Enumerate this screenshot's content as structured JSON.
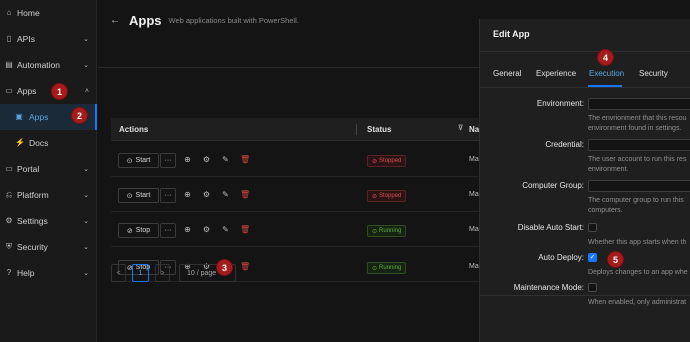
{
  "sidebar": {
    "items": [
      {
        "label": "Home",
        "icon": "home-icon"
      },
      {
        "label": "APIs",
        "icon": "api-icon"
      },
      {
        "label": "Automation",
        "icon": "automation-icon"
      },
      {
        "label": "Apps",
        "icon": "apps-icon"
      },
      {
        "label": "Apps",
        "icon": "app-icon"
      },
      {
        "label": "Docs",
        "icon": "docs-icon"
      },
      {
        "label": "Portal",
        "icon": "portal-icon"
      },
      {
        "label": "Platform",
        "icon": "platform-icon"
      },
      {
        "label": "Settings",
        "icon": "settings-icon"
      },
      {
        "label": "Security",
        "icon": "security-icon"
      },
      {
        "label": "Help",
        "icon": "help-icon"
      }
    ]
  },
  "page": {
    "title": "Apps",
    "subtitle": "Web applications built with PowerShell."
  },
  "table": {
    "headers": {
      "actions": "Actions",
      "status": "Status",
      "name": "Na"
    },
    "rows": [
      {
        "action": "Start",
        "status": "Stopped",
        "name": "Ma"
      },
      {
        "action": "Start",
        "status": "Stopped",
        "name": "Ma"
      },
      {
        "action": "Stop",
        "status": "Running",
        "name": "Ma"
      },
      {
        "action": "Stop",
        "status": "Running",
        "name": "Ma"
      }
    ],
    "more_label": "···"
  },
  "pagination": {
    "prev": "<",
    "current": "1",
    "next": ">",
    "page_size": "10 / page"
  },
  "drawer": {
    "title": "Edit App",
    "tabs": [
      "General",
      "Experience",
      "Execution",
      "Security"
    ],
    "active_tab": "Execution",
    "fields": {
      "environment": {
        "label": "Environment:",
        "help1": "The envrionment that this resou",
        "help2": "environment found in settings."
      },
      "credential": {
        "label": "Credential:",
        "help1": "The user account to run this res",
        "help2": "environment."
      },
      "computer_group": {
        "label": "Computer Group:",
        "help1": "The computer group to run this",
        "help2": "computers."
      },
      "disable_auto_start": {
        "label": "Disable Auto Start:",
        "checked": false,
        "help1": "Whether this app starts when th"
      },
      "auto_deploy": {
        "label": "Auto Deploy:",
        "checked": true,
        "help1": "Deploys changes to an app whe"
      },
      "maintenance_mode": {
        "label": "Maintenance Mode:",
        "checked": false,
        "help1": "When enabled, only administrat"
      }
    }
  },
  "markers": [
    "1",
    "2",
    "3",
    "4",
    "5"
  ],
  "colors": {
    "accent": "#1677ff",
    "marker": "#a61b1b",
    "stopped": "#d9534f",
    "running": "#5cae3b",
    "delete": "#d4453f"
  }
}
